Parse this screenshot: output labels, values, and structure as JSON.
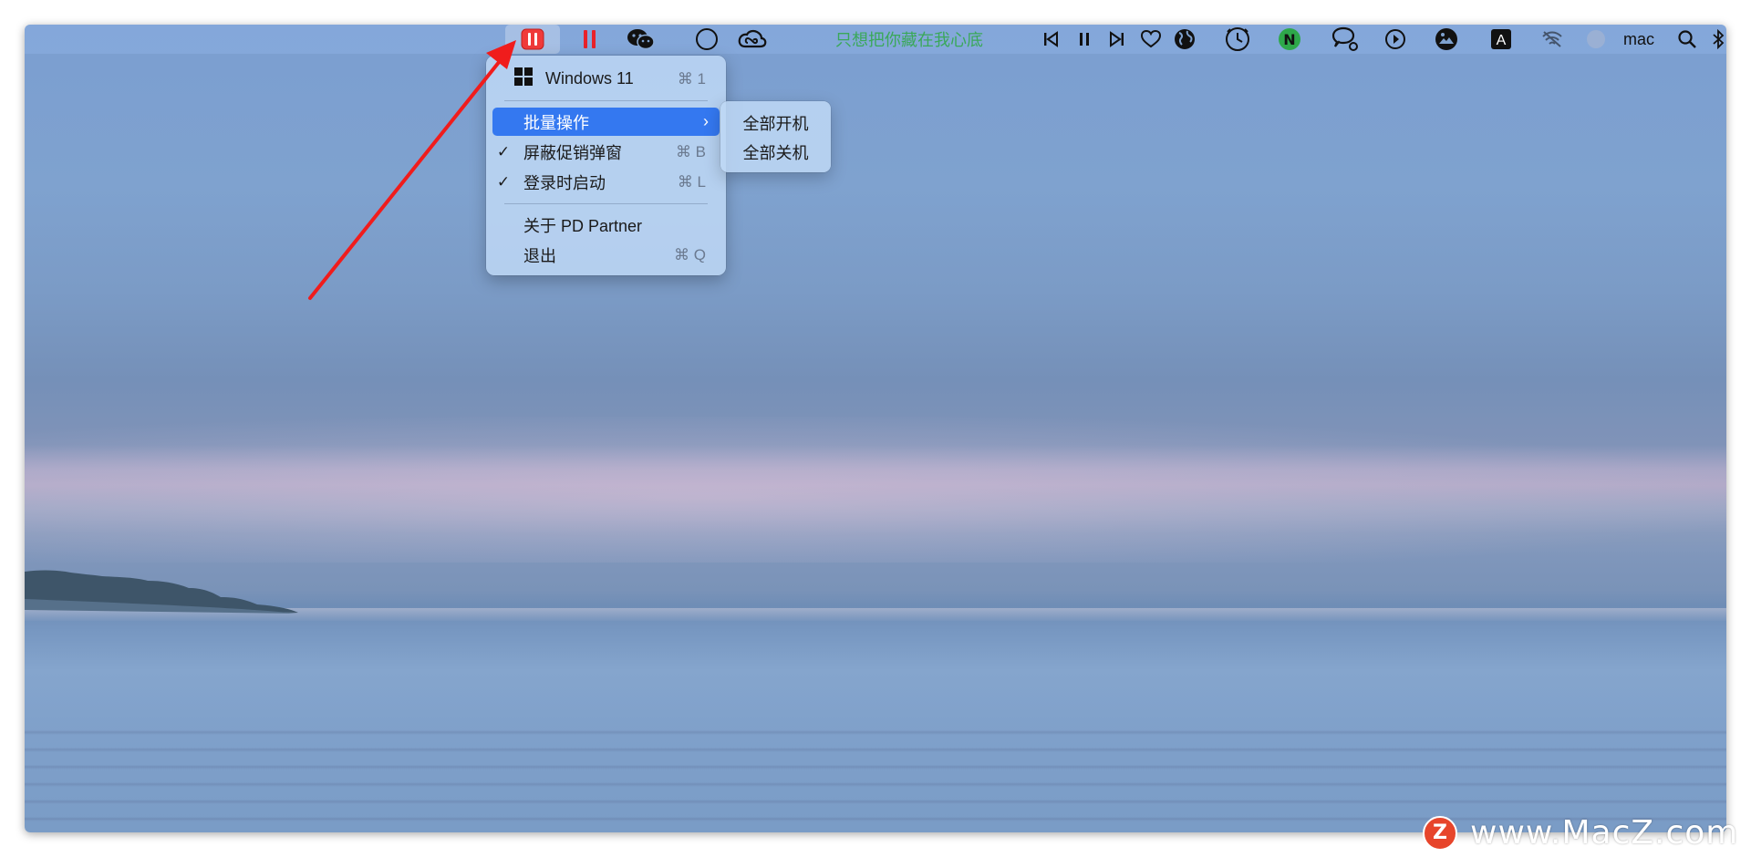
{
  "menubar": {
    "song_title": "只想把你藏在我心底",
    "user_name": "mac",
    "icons": [
      "pd-partner-icon",
      "parallels-icon",
      "wechat-icon",
      "circle-icon",
      "creative-cloud-icon",
      "previous-track-icon",
      "pause-icon",
      "next-track-icon",
      "heart-icon",
      "globe-icon",
      "clock-icon",
      "n-app-icon",
      "chat-bubble-icon",
      "play-icon",
      "image-icon",
      "input-method-icon",
      "wifi-icon",
      "avatar-icon",
      "search-icon",
      "bluetooth-icon"
    ],
    "input_method_letter": "A",
    "n_app_letter": "N"
  },
  "menu": {
    "items": [
      {
        "label": "Windows 11",
        "shortcut": "⌘ 1",
        "icon": "windows-icon"
      },
      {
        "label": "批量操作",
        "has_submenu": true,
        "highlighted": true
      },
      {
        "label": "屏蔽促销弹窗",
        "shortcut": "⌘ B",
        "checked": true
      },
      {
        "label": "登录时启动",
        "shortcut": "⌘ L",
        "checked": true
      },
      {
        "label": "关于 PD Partner"
      },
      {
        "label": "退出",
        "shortcut": "⌘ Q"
      }
    ],
    "check_glyph": "✓",
    "submenu_arrow": "›"
  },
  "submenu": {
    "items": [
      {
        "label": "全部开机"
      },
      {
        "label": "全部关机"
      }
    ]
  },
  "watermark": {
    "logo_letter": "Z",
    "text": "www.MacZ.com"
  },
  "colors": {
    "accent": "#3478f0",
    "annotation_arrow": "#f01c1c",
    "song_text": "#3aa85a"
  }
}
